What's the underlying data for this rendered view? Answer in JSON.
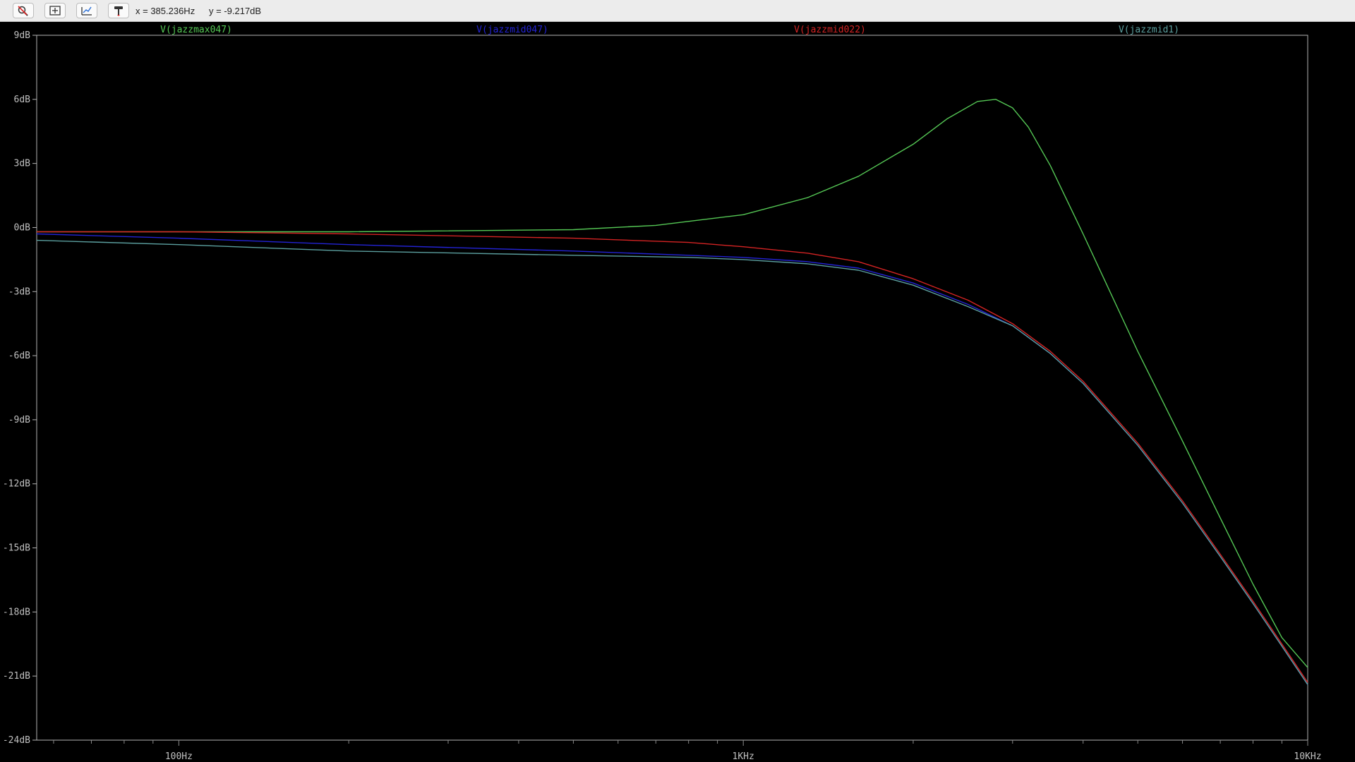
{
  "toolbar": {
    "buttons": [
      {
        "icon": "zoom-cancel-icon"
      },
      {
        "icon": "zoom-fit-icon"
      },
      {
        "icon": "autorange-icon"
      },
      {
        "icon": "probe-icon"
      }
    ],
    "cursor_x": "x = 385.236Hz",
    "cursor_y": "y = -9.217dB"
  },
  "colors": {
    "background": "#000000",
    "axis": "#b4b4b4",
    "grid_tick": "#8a8a8a",
    "label": "#c0c0c0"
  },
  "chart_data": {
    "type": "line",
    "x_scale": "log",
    "xlim": [
      56,
      10000
    ],
    "ylim": [
      -24,
      9
    ],
    "x_ticks": [
      {
        "value": 100,
        "label": "100Hz"
      },
      {
        "value": 1000,
        "label": "1KHz"
      },
      {
        "value": 10000,
        "label": "10KHz"
      }
    ],
    "y_ticks": [
      {
        "value": 9,
        "label": "9dB"
      },
      {
        "value": 6,
        "label": "6dB"
      },
      {
        "value": 3,
        "label": "3dB"
      },
      {
        "value": 0,
        "label": "0dB"
      },
      {
        "value": -3,
        "label": "-3dB"
      },
      {
        "value": -6,
        "label": "-6dB"
      },
      {
        "value": -9,
        "label": "-9dB"
      },
      {
        "value": -12,
        "label": "-12dB"
      },
      {
        "value": -15,
        "label": "-15dB"
      },
      {
        "value": -18,
        "label": "-18dB"
      },
      {
        "value": -21,
        "label": "-21dB"
      },
      {
        "value": -24,
        "label": "-24dB"
      }
    ],
    "series": [
      {
        "name": "V(jazzmax047)",
        "color": "#55c855",
        "x": [
          56,
          100,
          200,
          500,
          700,
          1000,
          1300,
          1600,
          2000,
          2300,
          2600,
          2800,
          3000,
          3200,
          3500,
          4000,
          5000,
          6000,
          7000,
          8000,
          9000,
          10000
        ],
        "y": [
          -0.2,
          -0.2,
          -0.2,
          -0.1,
          0.1,
          0.6,
          1.4,
          2.4,
          3.9,
          5.1,
          5.9,
          6.0,
          5.6,
          4.7,
          2.9,
          -0.3,
          -5.8,
          -10.0,
          -13.6,
          -16.7,
          -19.2,
          -20.6
        ]
      },
      {
        "name": "V(jazzmid047)",
        "color": "#2323d4",
        "x": [
          56,
          100,
          200,
          500,
          800,
          1000,
          1300,
          1600,
          2000,
          2500,
          3000,
          3500,
          4000,
          5000,
          6000,
          7000,
          8000,
          9000,
          10000
        ],
        "y": [
          -0.3,
          -0.5,
          -0.8,
          -1.1,
          -1.3,
          -1.4,
          -1.6,
          -1.9,
          -2.6,
          -3.6,
          -4.6,
          -5.9,
          -7.3,
          -10.2,
          -12.9,
          -15.4,
          -17.6,
          -19.6,
          -21.4
        ]
      },
      {
        "name": "V(jazzmid022)",
        "color": "#d42323",
        "x": [
          56,
          100,
          200,
          500,
          800,
          1000,
          1300,
          1600,
          2000,
          2500,
          3000,
          3500,
          4000,
          5000,
          6000,
          7000,
          8000,
          9000,
          10000
        ],
        "y": [
          -0.2,
          -0.2,
          -0.3,
          -0.5,
          -0.7,
          -0.9,
          -1.2,
          -1.6,
          -2.4,
          -3.4,
          -4.5,
          -5.8,
          -7.2,
          -10.1,
          -12.8,
          -15.3,
          -17.5,
          -19.5,
          -21.3
        ]
      },
      {
        "name": "V(jazzmid1)",
        "color": "#5b9f9f",
        "x": [
          56,
          100,
          200,
          500,
          800,
          1000,
          1300,
          1600,
          2000,
          2500,
          3000,
          3500,
          4000,
          5000,
          6000,
          7000,
          8000,
          9000,
          10000
        ],
        "y": [
          -0.6,
          -0.8,
          -1.1,
          -1.3,
          -1.4,
          -1.5,
          -1.7,
          -2.0,
          -2.7,
          -3.7,
          -4.6,
          -5.9,
          -7.3,
          -10.2,
          -12.9,
          -15.4,
          -17.6,
          -19.6,
          -21.4
        ]
      }
    ]
  }
}
